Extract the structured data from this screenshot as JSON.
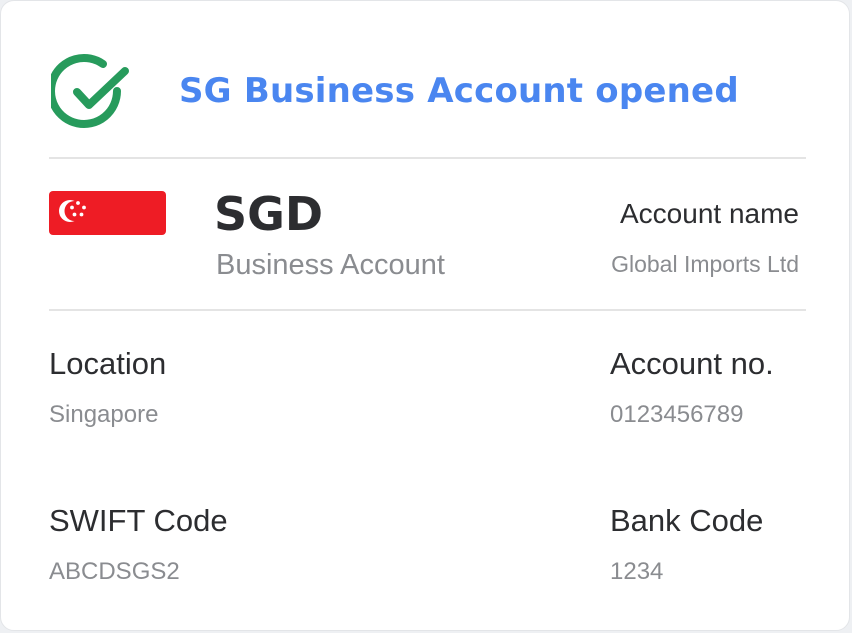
{
  "header": {
    "title": "SG Business Account opened",
    "status_color": "#279b5c",
    "title_color": "#4a86f0"
  },
  "account": {
    "currency_code": "SGD",
    "account_type": "Business Account",
    "flag": "singapore-flag-icon",
    "account_name_label": "Account name",
    "account_name_value": "Global Imports Ltd"
  },
  "details": {
    "location_label": "Location",
    "location_value": "Singapore",
    "account_no_label": "Account no.",
    "account_no_value": "0123456789",
    "swift_label": "SWIFT Code",
    "swift_value": "ABCDSGS2",
    "bank_code_label": "Bank Code",
    "bank_code_value": "1234"
  }
}
